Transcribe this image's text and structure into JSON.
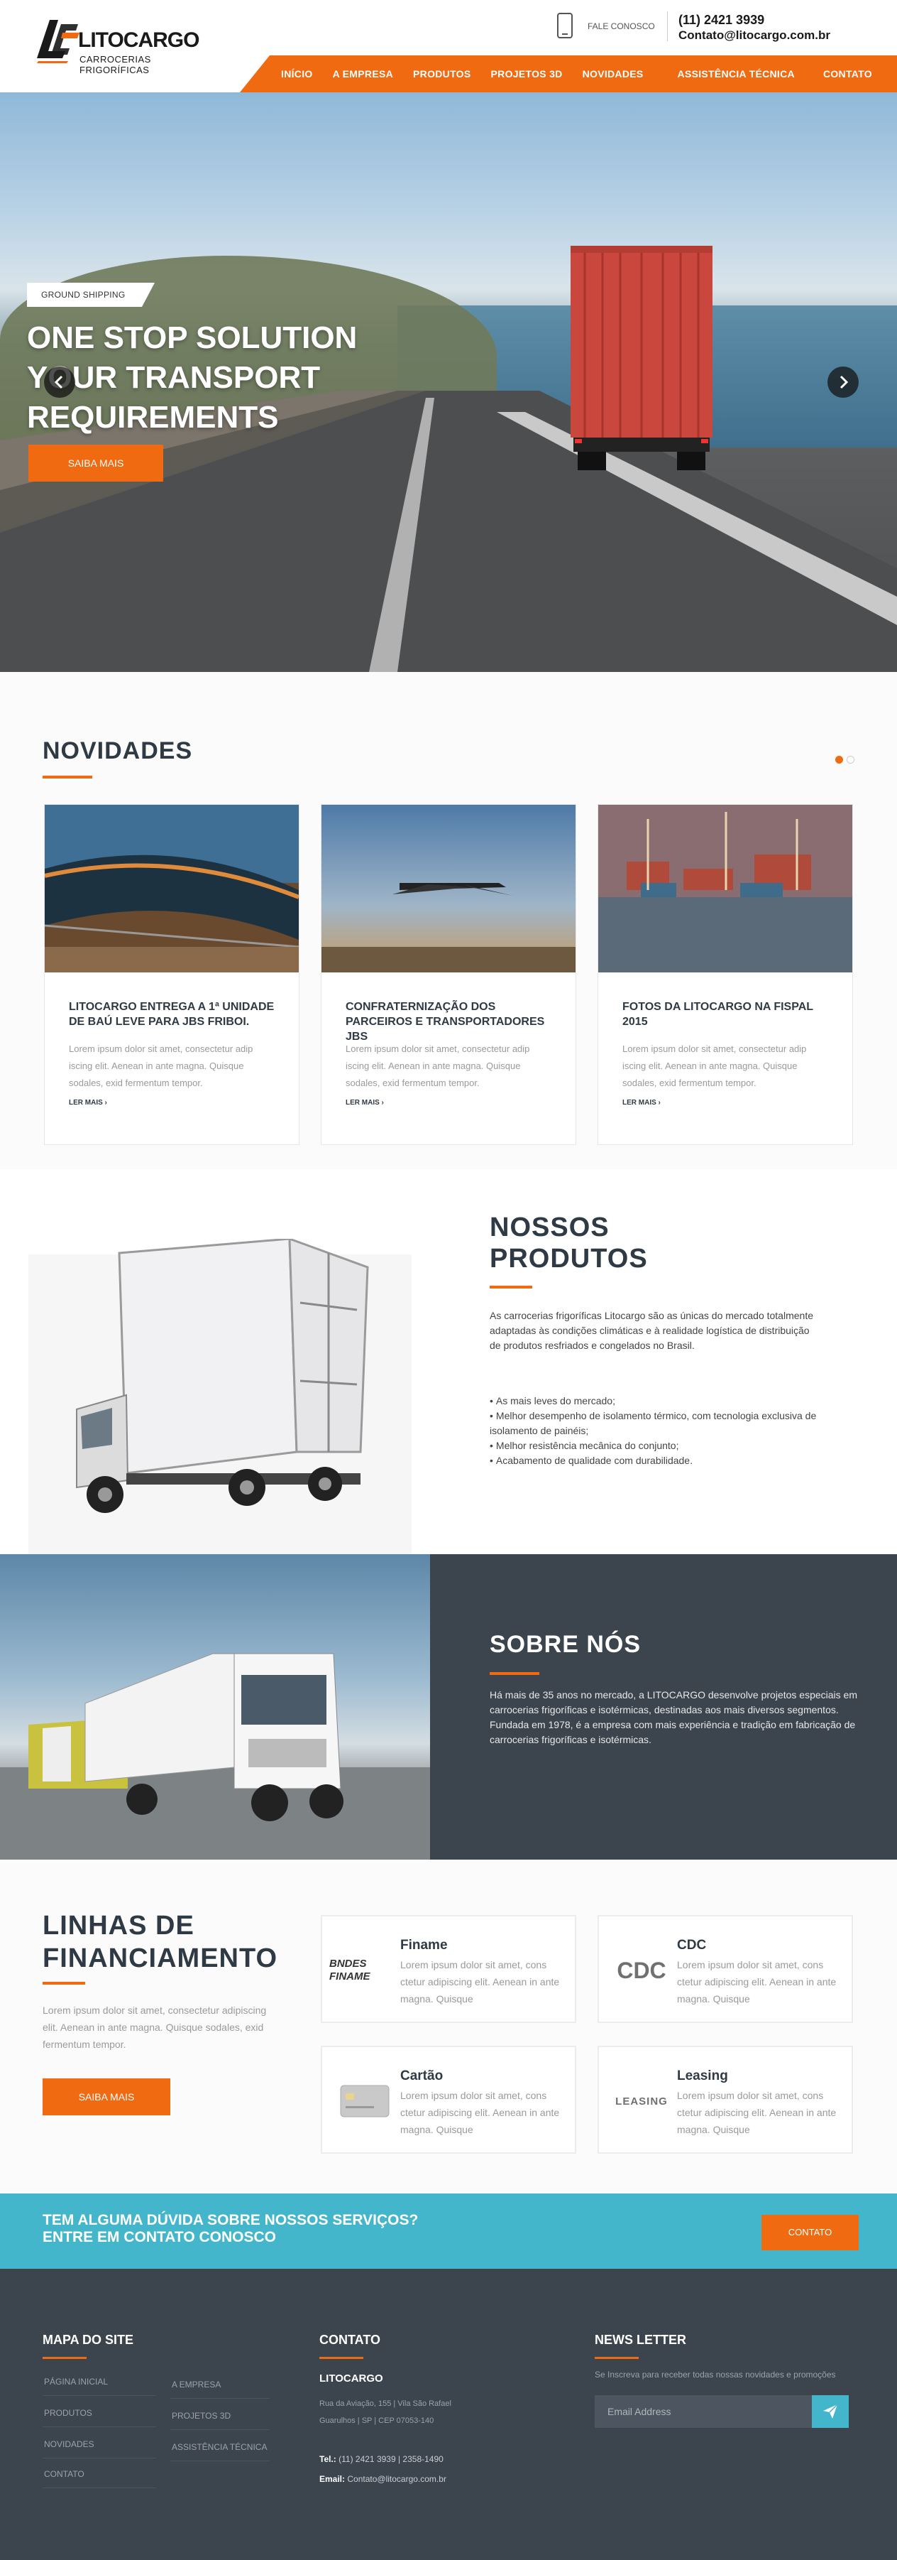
{
  "header": {
    "logo_name": "LITOCARGO",
    "logo_sub": "CARROCERIAS  FRIGORÍFICAS",
    "fale_label": "FALE CONOSCO",
    "phone": "(11) 2421 3939",
    "email": "Contato@litocargo.com.br"
  },
  "nav": {
    "items": [
      "INÍCIO",
      "A EMPRESA",
      "PRODUTOS",
      "PROJETOS 3D",
      "NOVIDADES",
      "ASSISTÊNCIA TÉCNICA",
      "CONTATO"
    ]
  },
  "hero": {
    "tag": "GROUND SHIPPING",
    "title_line1": "ONE STOP SOLUTION",
    "title_line2": "YOUR TRANSPORT",
    "title_line3": "REQUIREMENTS",
    "button": "SAIBA MAIS"
  },
  "news": {
    "title": "NOVIDADES",
    "cards": [
      {
        "title": "LITOCARGO ENTREGA A 1ª UNIDADE DE BAÚ LEVE PARA JBS FRIBOI.",
        "text": "Lorem ipsum dolor sit amet, consectetur adip iscing elit. Aenean in ante magna. Quisque sodales, exid fermentum tempor.",
        "more": "LER MAIS  ›"
      },
      {
        "title": "CONFRATERNIZAÇÃO DOS PARCEIROS E TRANSPORTADORES JBS",
        "text": "Lorem ipsum dolor sit amet, consectetur adip iscing elit. Aenean in ante magna. Quisque sodales, exid fermentum tempor.",
        "more": "LER MAIS  ›"
      },
      {
        "title": "FOTOS DA LITOCARGO NA FISPAL 2015",
        "text": "Lorem ipsum dolor sit amet, consectetur adip iscing elit. Aenean in ante magna. Quisque sodales, exid fermentum tempor.",
        "more": "LER MAIS  ›"
      }
    ]
  },
  "products": {
    "title_line1": "NOSSOS",
    "title_line2": "PRODUTOS",
    "description": "As carrocerias frigoríficas Litocargo são as únicas do mercado totalmente adaptadas às condições climáticas e à realidade logística de distribuição de produtos resfriados e congelados no Brasil.",
    "features": [
      "As mais leves do mercado;",
      "Melhor desempenho de isolamento térmico, com tecnologia exclusiva de isolamento de painéis;",
      "Melhor resistência mecânica do conjunto;",
      "Acabamento de qualidade com durabilidade."
    ]
  },
  "about": {
    "title": "SOBRE NÓS",
    "text": "Há mais de 35 anos no mercado, a LITOCARGO desenvolve projetos especiais em carrocerias frigoríficas e isotérmicas, destinadas aos mais diversos segmentos. Fundada em 1978, é a empresa com mais experiência e tradição em fabricação de carrocerias frigoríficas e isotérmicas."
  },
  "finance": {
    "title_line1": "LINHAS DE",
    "title_line2": "FINANCIAMENTO",
    "text": "Lorem ipsum dolor sit amet, consectetur adipiscing elit. Aenean in ante magna. Quisque sodales, exid fermentum tempor.",
    "button": "SAIBA MAIS",
    "cards": [
      {
        "name": "Finame",
        "logo": "BNDES FINAME",
        "desc": "Lorem ipsum dolor sit amet, cons ctetur adipiscing elit. Aenean in ante magna. Quisque"
      },
      {
        "name": "CDC",
        "logo": "CDC",
        "desc": "Lorem ipsum dolor sit amet, cons ctetur adipiscing elit. Aenean in ante magna. Quisque"
      },
      {
        "name": "Cartão",
        "logo": "card",
        "desc": "Lorem ipsum dolor sit amet, cons ctetur adipiscing elit. Aenean in ante magna. Quisque"
      },
      {
        "name": "Leasing",
        "logo": "LEASING",
        "desc": "Lorem ipsum dolor sit amet, cons ctetur adipiscing elit. Aenean in ante magna. Quisque"
      }
    ]
  },
  "cta": {
    "line1": "TEM ALGUMA DÚVIDA SOBRE NOSSOS SERVIÇOS?",
    "line2": "ENTRE EM CONTATO CONOSCO",
    "button": "CONTATO"
  },
  "footer": {
    "sitemap_title": "MAPA DO SITE",
    "sitemap_left": [
      "PÁGINA INICIAL",
      "PRODUTOS",
      "NOVIDADES",
      "CONTATO"
    ],
    "sitemap_right": [
      "A EMPRESA",
      "PROJETOS 3D",
      "ASSISTÊNCIA TÉCNICA"
    ],
    "contact_title": "CONTATO",
    "company": "LITOCARGO",
    "address_line1": "Rua da Aviação, 155 | Vila São Rafael",
    "address_line2": "Guarulhos | SP | CEP 07053-140",
    "tel_label": "Tel.:",
    "tel": "(11) 2421 3939 | 2358-1490",
    "email_label": "Email:",
    "email": "Contato@litocargo.com.br",
    "newsletter_title": "NEWS LETTER",
    "newsletter_text": "Se Inscreva para receber todas nossas novidades e promoções",
    "newsletter_placeholder": "Email Address"
  },
  "colors": {
    "accent": "#f06a12",
    "dark": "#3c444e",
    "cyan": "#44b6cc",
    "heading": "#2f3a45"
  }
}
